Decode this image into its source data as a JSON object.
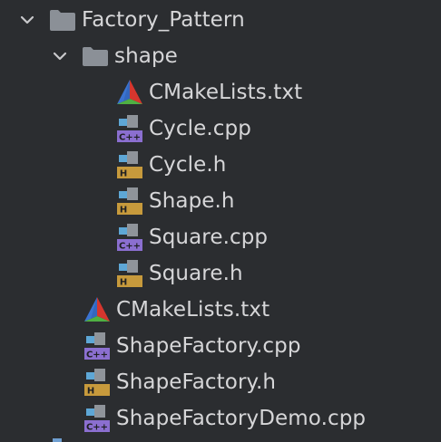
{
  "project_tree": {
    "root": {
      "label": "Factory_Pattern",
      "icon": "folder-icon",
      "expanded": true
    },
    "shape_folder": {
      "label": "shape",
      "icon": "folder-icon",
      "expanded": true
    },
    "shape_files": [
      {
        "label": "CMakeLists.txt",
        "icon": "cmake-icon"
      },
      {
        "label": "Cycle.cpp",
        "icon": "cpp-file-icon"
      },
      {
        "label": "Cycle.h",
        "icon": "header-file-icon"
      },
      {
        "label": "Shape.h",
        "icon": "header-file-icon"
      },
      {
        "label": "Square.cpp",
        "icon": "cpp-file-icon"
      },
      {
        "label": "Square.h",
        "icon": "header-file-icon"
      }
    ],
    "root_files": [
      {
        "label": "CMakeLists.txt",
        "icon": "cmake-icon"
      },
      {
        "label": "ShapeFactory.cpp",
        "icon": "cpp-file-icon"
      },
      {
        "label": "ShapeFactory.h",
        "icon": "header-file-icon"
      },
      {
        "label": "ShapeFactoryDemo.cpp",
        "icon": "cpp-file-icon"
      }
    ],
    "icon_badges": {
      "cpp": "C++",
      "header": "H"
    }
  },
  "colors": {
    "background": "#2b2d30",
    "text": "#d6d6d8",
    "folder": "#8b9097",
    "file_doc_gray": "#8f949a",
    "file_doc_blue": "#5ea7d6",
    "cpp_badge": "#8b6fd0",
    "header_badge": "#c79a3c"
  }
}
